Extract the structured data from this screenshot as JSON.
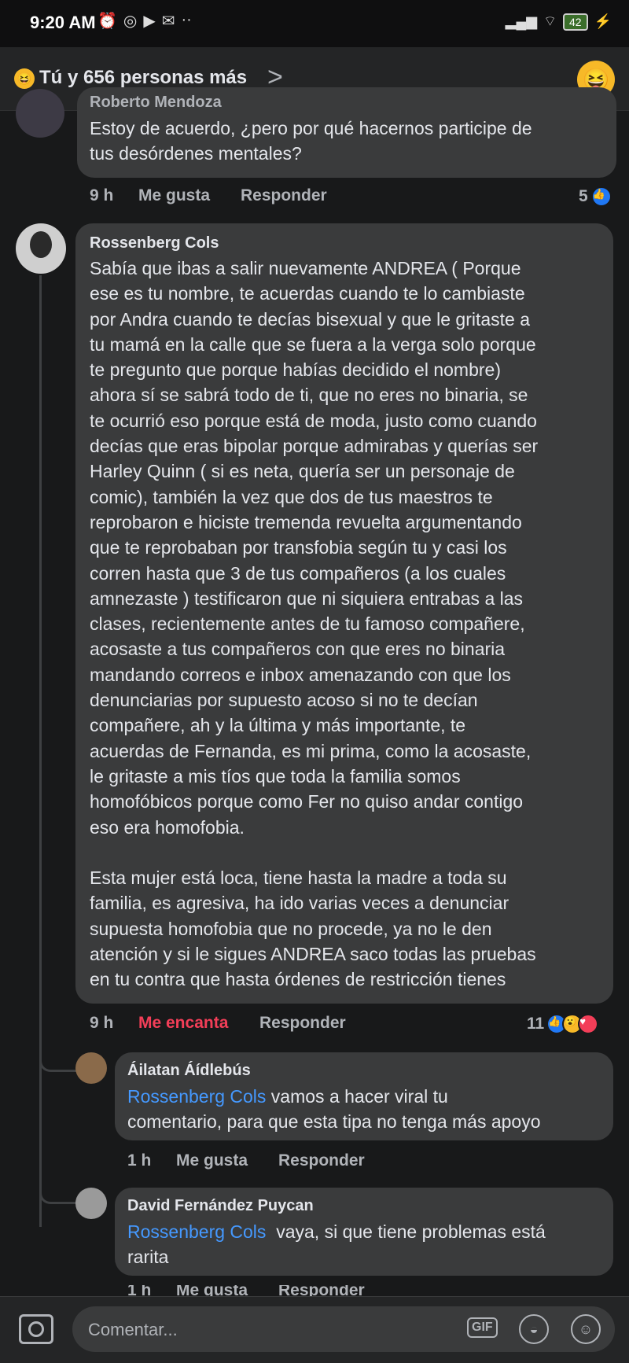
{
  "status_bar": {
    "time": "9:20 AM",
    "icons": [
      "alarm-icon",
      "whatsapp-icon",
      "youtube-icon",
      "gmail-icon"
    ],
    "more": "··",
    "battery": "42"
  },
  "header": {
    "reactions_label": "Tú y 656 personas más",
    "chevron": ">",
    "emoji": "laughing-emoji"
  },
  "comments": [
    {
      "author": "Roberto Mendoza",
      "text": "Estoy de acuerdo, ¿pero por qué hacernos participe de\ntus desórdenes mentales?",
      "time": "9 h",
      "like": "Me gusta",
      "reply": "Responder",
      "reaction_count": "5"
    },
    {
      "author": "Rossenberg Cols",
      "text": "Sabía que ibas a salir nuevamente ANDREA ( Porque\nese es tu nombre, te acuerdas cuando te lo cambiaste\npor Andra cuando te decías bisexual y que le gritaste a\ntu mamá en la calle que se fuera a la verga solo porque\nte pregunto que porque habías decidido el nombre)\nahora sí se sabrá todo de ti, que no eres no binaria, se\nte ocurrió eso porque está de moda, justo como cuando\ndecías que eras bipolar porque admirabas y querías ser\nHarley Quinn ( si es neta, quería ser un personaje de\ncomic), también la vez que dos de tus maestros te\nreprobaron e hiciste tremenda revuelta argumentando\nque te reprobaban por transfobia según tu y casi los\ncorren hasta que 3 de tus compañeros (a los cuales\namnezaste ) testificaron que ni siquiera entrabas a las\nclases, recientemente antes de tu famoso compañere,\nacosaste a tus compañeros con que eres no binaria\nmandando correos e inbox amenazando con que los\ndenunciarias por supuesto acoso si no te decían\ncompañere, ah y la última y más importante, te\nacuerdas de Fernanda, es mi prima, como la acosaste,\nle gritaste a mis tíos que toda la familia somos\nhomofóbicos porque como Fer no quiso andar contigo\neso era homofobia.\n\nEsta mujer está loca, tiene hasta la madre a toda su\nfamilia, es agresiva, ha ido varias veces a denunciar\nsupuesta homofobia que no procede, ya no le den\natención y si le sigues ANDREA saco todas las pruebas\nen tu contra que hasta órdenes de restricción tienes",
      "time": "9 h",
      "like": "Me encanta",
      "reply": "Responder",
      "reaction_count": "11"
    },
    {
      "author": "Áilatan Áídlebús",
      "tag": "Rossenberg Cols",
      "text": " vamos a hacer viral tu\ncomentario, para que esta tipa no tenga más apoyo",
      "time": "1 h",
      "like": "Me gusta",
      "reply": "Responder"
    },
    {
      "author": "David Fernández Puycan",
      "tag": "Rossenberg Cols",
      "text": "  vaya, si que tiene problemas está\nrarita",
      "time": "1 h",
      "like": "Me gusta",
      "reply": "Responder"
    }
  ],
  "composer": {
    "placeholder": "Comentar...",
    "gif_label": "GIF",
    "icons": [
      "camera-icon",
      "gif-icon",
      "sticker-icon",
      "emoji-icon"
    ]
  },
  "colors": {
    "background": "#18191a",
    "bubble": "#3a3b3c",
    "love_red": "#f33e58",
    "link_blue": "#4599ff",
    "like_blue": "#2078f4"
  }
}
